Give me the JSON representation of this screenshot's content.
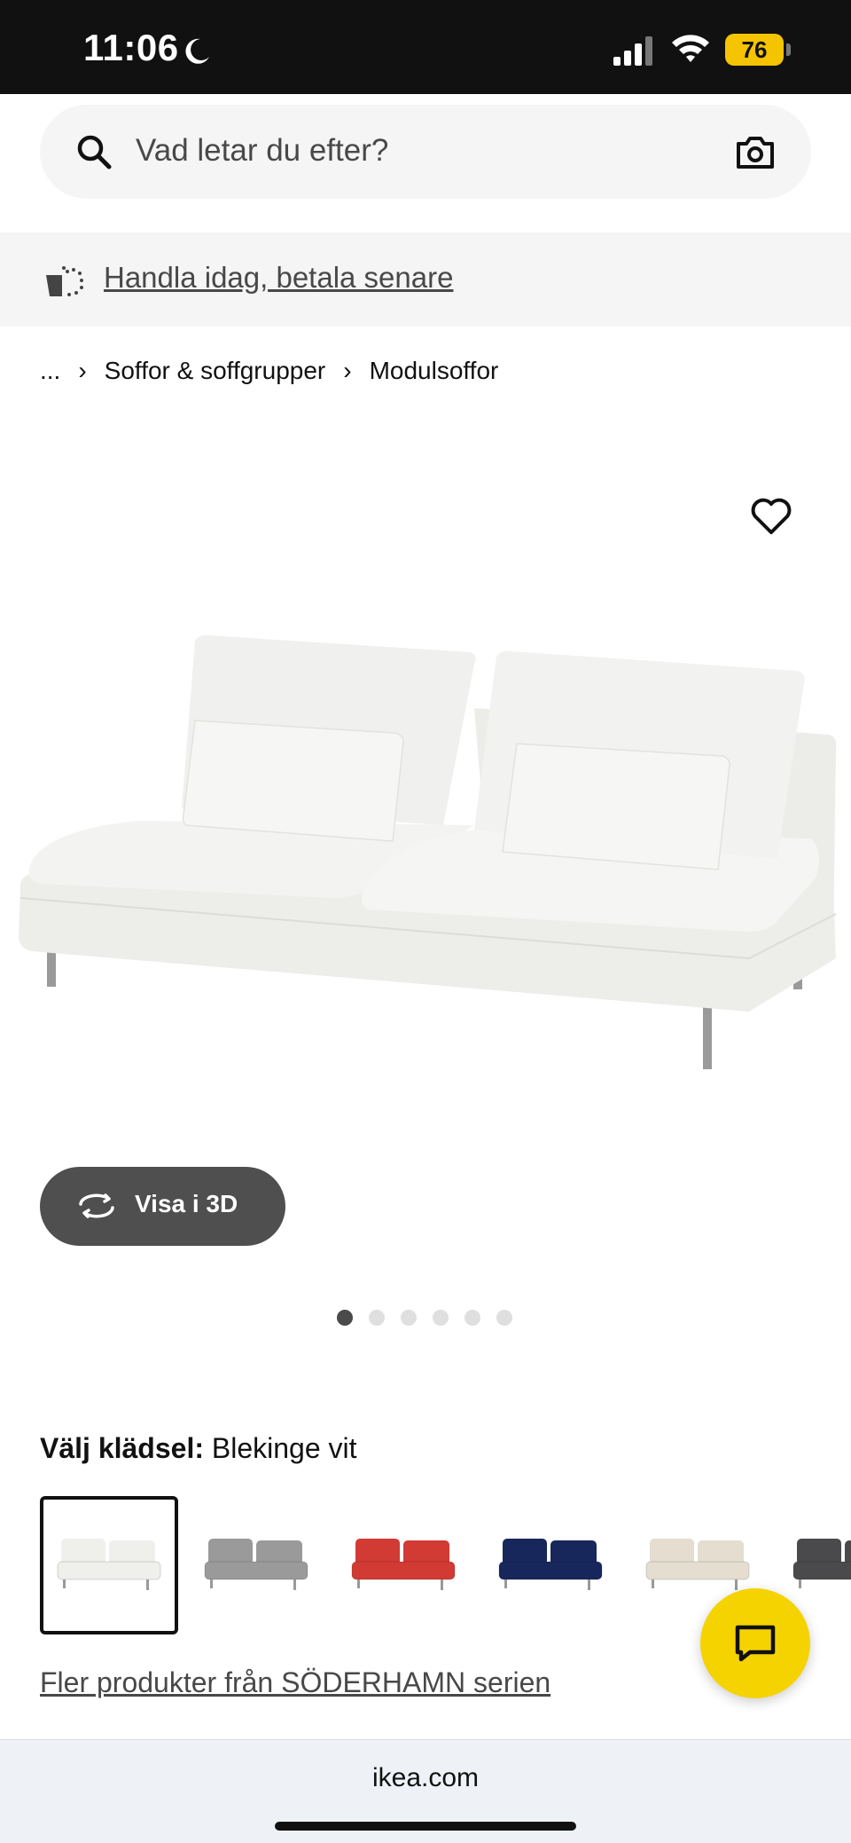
{
  "status_bar": {
    "time": "11:06",
    "battery": "76"
  },
  "search": {
    "placeholder": "Vad letar du efter?"
  },
  "promo": {
    "text": "Handla idag, betala senare"
  },
  "breadcrumb": {
    "ellipsis": "...",
    "items": [
      "Soffor & soffgrupper",
      "Modulsoffor"
    ]
  },
  "product": {
    "view_3d_label": "Visa i 3D",
    "image_count": 6,
    "active_image": 1
  },
  "material": {
    "label": "Välj klädsel:",
    "value": "Blekinge vit",
    "swatches": [
      {
        "name": "Blekinge vit",
        "color": "#efefec",
        "selected": true
      },
      {
        "name": "grey",
        "color": "#9a9a9a",
        "selected": false
      },
      {
        "name": "red",
        "color": "#d23a34",
        "selected": false
      },
      {
        "name": "dark blue",
        "color": "#17275c",
        "selected": false
      },
      {
        "name": "beige",
        "color": "#e4ddd0",
        "selected": false
      },
      {
        "name": "dark grey",
        "color": "#4a4a4d",
        "selected": false
      }
    ]
  },
  "more_link": "Fler produkter från SÖDERHAMN serien",
  "urlbar": {
    "url": "ikea.com"
  }
}
